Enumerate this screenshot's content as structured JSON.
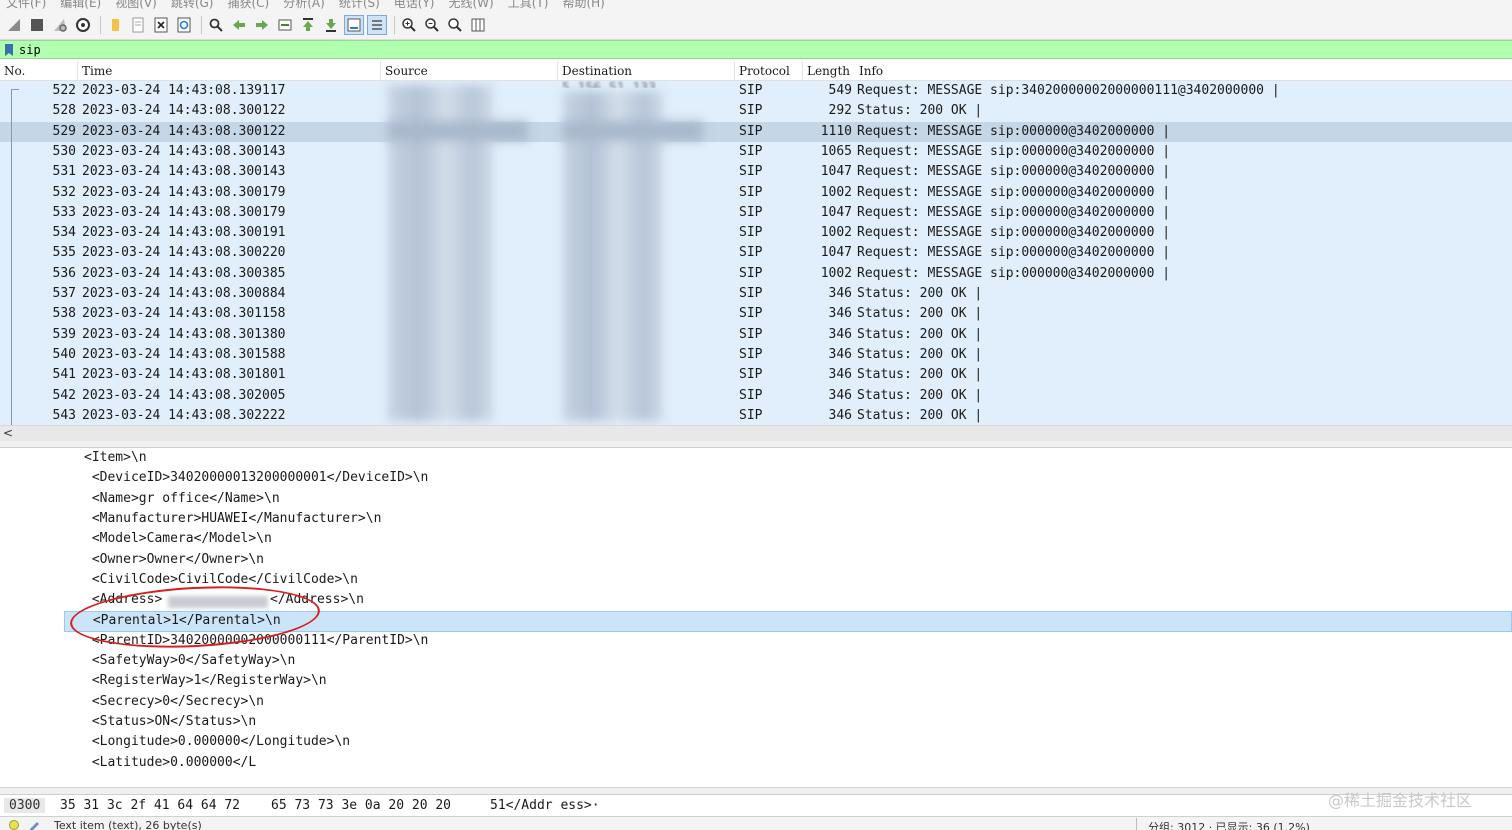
{
  "menu": [
    "文件(F)",
    "编辑(E)",
    "视图(V)",
    "跳转(G)",
    "捕获(C)",
    "分析(A)",
    "统计(S)",
    "电话(Y)",
    "无线(W)",
    "工具(T)",
    "帮助(H)"
  ],
  "toolbar": {
    "icons": [
      "shark-fin-icon",
      "stop-icon",
      "restart-icon",
      "options-gear-icon",
      "open-folder-icon",
      "file-icon",
      "close-file-icon",
      "reload-icon",
      "find-icon",
      "back-arrow-icon",
      "forward-arrow-icon",
      "goto-packet-icon",
      "first-packet-icon",
      "last-packet-icon",
      "autoscroll-icon",
      "colorize-icon",
      "zoom-in-icon",
      "zoom-out-icon",
      "zoom-reset-icon",
      "resize-columns-icon"
    ]
  },
  "filter": {
    "value": "sip"
  },
  "packet_list": {
    "columns": [
      "No.",
      "Time",
      "Source",
      "Destination",
      "Protocol",
      "Length",
      "Info"
    ],
    "destination_partial": "5.156.51.133",
    "rows": [
      {
        "no": "522",
        "time": "2023-03-24 14:43:08.139117",
        "protocol": "SIP",
        "length": "549",
        "info": "Request: MESSAGE sip:34020000002000000111@3402000000 |"
      },
      {
        "no": "528",
        "time": "2023-03-24 14:43:08.300122",
        "protocol": "SIP",
        "length": "292",
        "info": "Status: 200 OK |"
      },
      {
        "no": "529",
        "time": "2023-03-24 14:43:08.300122",
        "protocol": "SIP",
        "length": "1110",
        "info": "Request: MESSAGE sip:000000@3402000000 |"
      },
      {
        "no": "530",
        "time": "2023-03-24 14:43:08.300143",
        "protocol": "SIP",
        "length": "1065",
        "info": "Request: MESSAGE sip:000000@3402000000 |"
      },
      {
        "no": "531",
        "time": "2023-03-24 14:43:08.300143",
        "protocol": "SIP",
        "length": "1047",
        "info": "Request: MESSAGE sip:000000@3402000000 |"
      },
      {
        "no": "532",
        "time": "2023-03-24 14:43:08.300179",
        "protocol": "SIP",
        "length": "1002",
        "info": "Request: MESSAGE sip:000000@3402000000 |"
      },
      {
        "no": "533",
        "time": "2023-03-24 14:43:08.300179",
        "protocol": "SIP",
        "length": "1047",
        "info": "Request: MESSAGE sip:000000@3402000000 |"
      },
      {
        "no": "534",
        "time": "2023-03-24 14:43:08.300191",
        "protocol": "SIP",
        "length": "1002",
        "info": "Request: MESSAGE sip:000000@3402000000 |"
      },
      {
        "no": "535",
        "time": "2023-03-24 14:43:08.300220",
        "protocol": "SIP",
        "length": "1047",
        "info": "Request: MESSAGE sip:000000@3402000000 |"
      },
      {
        "no": "536",
        "time": "2023-03-24 14:43:08.300385",
        "protocol": "SIP",
        "length": "1002",
        "info": "Request: MESSAGE sip:000000@3402000000 |"
      },
      {
        "no": "537",
        "time": "2023-03-24 14:43:08.300884",
        "protocol": "SIP",
        "length": "346",
        "info": "Status: 200 OK |"
      },
      {
        "no": "538",
        "time": "2023-03-24 14:43:08.301158",
        "protocol": "SIP",
        "length": "346",
        "info": "Status: 200 OK |"
      },
      {
        "no": "539",
        "time": "2023-03-24 14:43:08.301380",
        "protocol": "SIP",
        "length": "346",
        "info": "Status: 200 OK |"
      },
      {
        "no": "540",
        "time": "2023-03-24 14:43:08.301588",
        "protocol": "SIP",
        "length": "346",
        "info": "Status: 200 OK |"
      },
      {
        "no": "541",
        "time": "2023-03-24 14:43:08.301801",
        "protocol": "SIP",
        "length": "346",
        "info": "Status: 200 OK |"
      },
      {
        "no": "542",
        "time": "2023-03-24 14:43:08.302005",
        "protocol": "SIP",
        "length": "346",
        "info": "Status: 200 OK |"
      },
      {
        "no": "543",
        "time": "2023-03-24 14:43:08.302222",
        "protocol": "SIP",
        "length": "346",
        "info": "Status: 200 OK |"
      }
    ]
  },
  "detail": {
    "lines": [
      "<Item>\\n",
      " <DeviceID>34020000013200000001</DeviceID>\\n",
      " <Name>gr office</Name>\\n",
      " <Manufacturer>HUAWEI</Manufacturer>\\n",
      " <Model>Camera</Model>\\n",
      " <Owner>Owner</Owner>\\n",
      " <CivilCode>CivilCode</CivilCode>\\n",
      " <Address>",
      " <Parental>1</Parental>\\n",
      " <ParentID>34020000002000000111</ParentID>\\n",
      " <SafetyWay>0</SafetyWay>\\n",
      " <RegisterWay>1</RegisterWay>\\n",
      " <Secrecy>0</Secrecy>\\n",
      " <Status>ON</Status>\\n",
      " <Longitude>0.000000</Longitude>\\n",
      " <Latitude>0.000000</L"
    ],
    "address_tail": "</Address>\\n"
  },
  "bytes": {
    "offset": "0300",
    "hex1": "35 31 3c 2f 41 64 64 72",
    "hex2": "65 73 73 3e 0a 20 20 20",
    "ascii": "51</Addr ess>·"
  },
  "watermark": "@稀土掘金技术社区",
  "status": {
    "item": "Text item (text), 26 byte(s)",
    "packets": "分组: 3012 · 已显示: 36 (1.2%)"
  }
}
